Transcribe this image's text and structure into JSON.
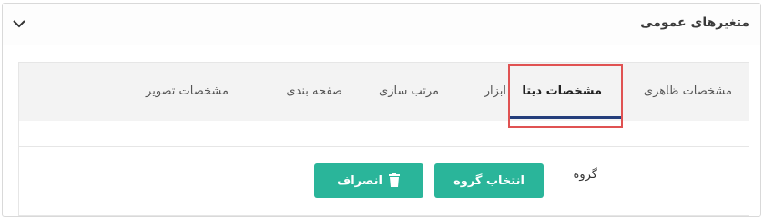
{
  "panel": {
    "title": "متغیرهای عمومی"
  },
  "tabs": [
    {
      "label": "مشخصات ظاهری",
      "active": false
    },
    {
      "label": "مشخصات دیتا",
      "active": true
    },
    {
      "label": "ابزار",
      "active": false
    },
    {
      "label": "مرتب سازی",
      "active": false
    },
    {
      "label": "صفحه بندی",
      "active": false
    },
    {
      "label": "مشخصات تصویر",
      "active": false
    }
  ],
  "form": {
    "group_label": "گروه",
    "select_group_button": "انتخاب گروه",
    "cancel_button": "انصراف"
  },
  "colors": {
    "accent": "#2ab59a",
    "active_tab_underline": "#243e7b",
    "highlight_border": "#e05252"
  }
}
